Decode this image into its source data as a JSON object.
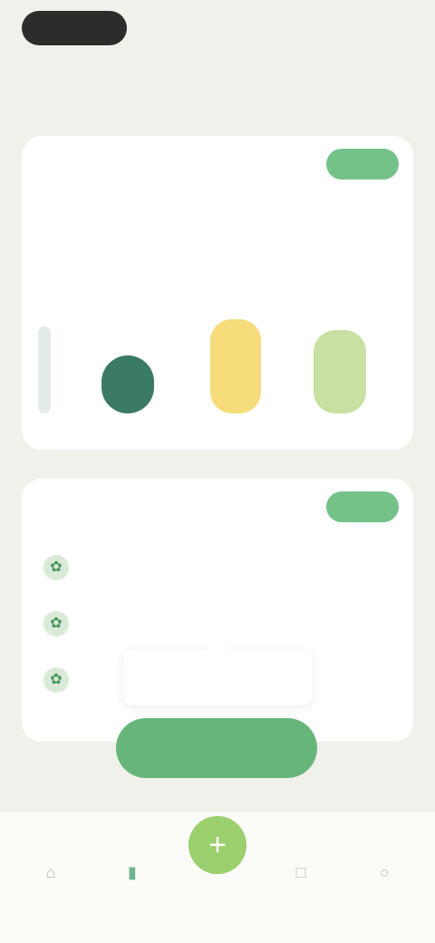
{
  "status_bar": {
    "time": "",
    "indicators": ""
  },
  "header": {
    "title": ""
  },
  "card_a": {
    "title": "",
    "chip": "",
    "left_label": "",
    "right_label": "",
    "right_value": "",
    "levels": [
      0.55,
      0.37,
      0.6,
      0.53
    ]
  },
  "card_b": {
    "title": "",
    "chip": "",
    "items": [
      {
        "icon": "leaf-icon",
        "text": "",
        "meta": ""
      },
      {
        "icon": "leaf-icon",
        "text": "",
        "meta": ""
      },
      {
        "icon": "leaf-icon",
        "text": "",
        "meta": ""
      }
    ]
  },
  "tooltip": {
    "line1": "",
    "line2": ""
  },
  "cta": {
    "label": ""
  },
  "tabbar": {
    "fab_icon": "plus-icon",
    "tabs": [
      {
        "icon": "home-icon",
        "label": ""
      },
      {
        "icon": "chart-icon",
        "label": ""
      },
      {
        "icon": "calendar-icon",
        "label": ""
      },
      {
        "icon": "profile-icon",
        "label": ""
      }
    ]
  },
  "colors": {
    "background": "#f0f1ea",
    "accent": "#74c28a",
    "cta": "#67b57a",
    "fab": "#9ccf6e",
    "gauge_dark": "#3b7a66",
    "gauge_yellow": "#f6dc7a",
    "gauge_light": "#c8e0a2"
  }
}
